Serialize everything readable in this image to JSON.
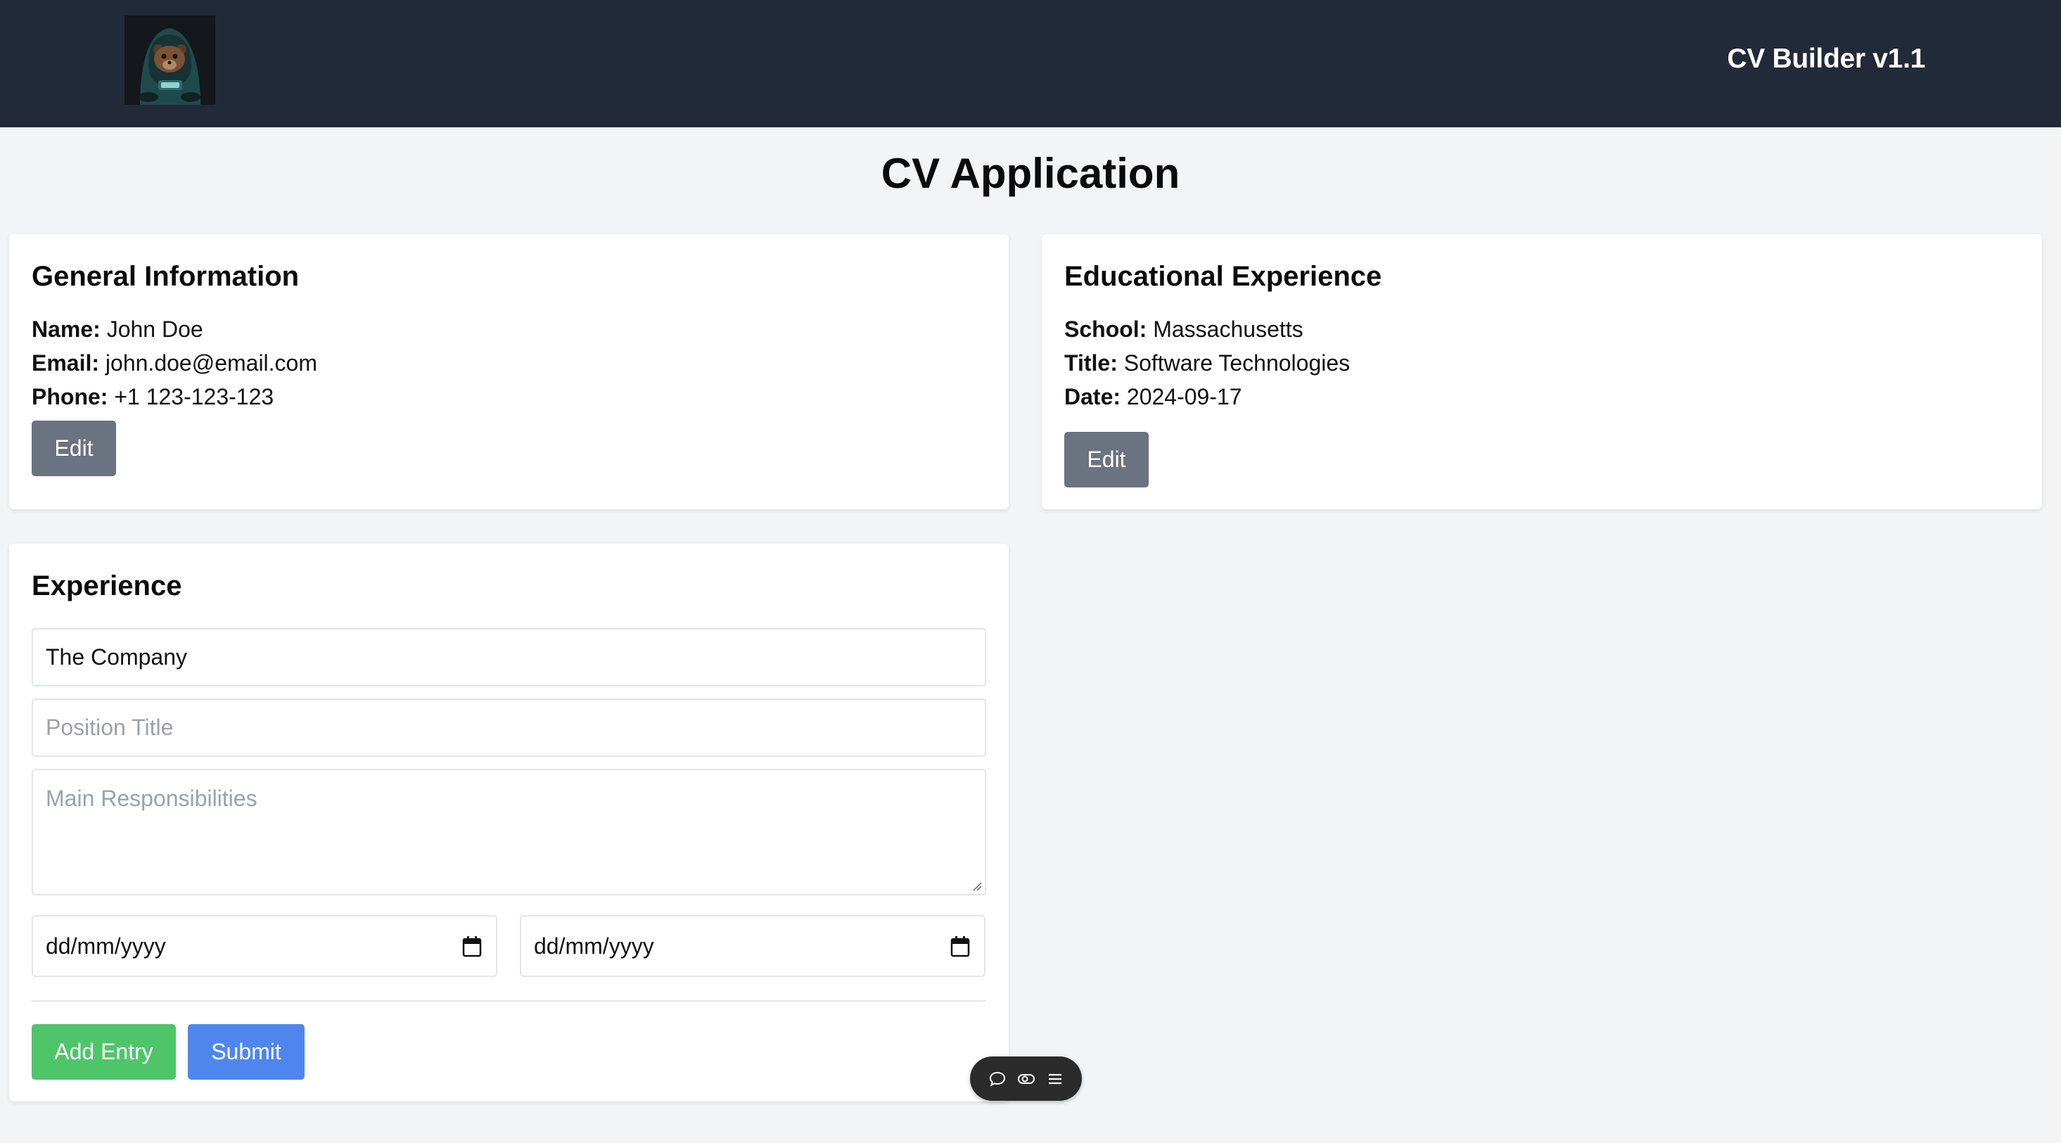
{
  "header": {
    "brand": "CV Builder v1.1",
    "logo_icon": "bear-hoodie-logo"
  },
  "page": {
    "title": "CV Application"
  },
  "general": {
    "title": "General Information",
    "name_label": "Name:",
    "name_value": "John Doe",
    "email_label": "Email:",
    "email_value": "john.doe@email.com",
    "phone_label": "Phone:",
    "phone_value": "+1 123-123-123",
    "edit_label": "Edit"
  },
  "education": {
    "title": "Educational Experience",
    "school_label": "School:",
    "school_value": "Massachusetts",
    "title_label": "Title:",
    "title_value": "Software Technologies",
    "date_label": "Date:",
    "date_value": "2024-09-17",
    "edit_label": "Edit"
  },
  "experience": {
    "title": "Experience",
    "company_value": "The Company",
    "position_placeholder": "Position Title",
    "responsibilities_placeholder": "Main Responsibilities",
    "start_date_placeholder": "dd/mm/yyyy",
    "end_date_placeholder": "dd/mm/yyyy",
    "add_label": "Add Entry",
    "submit_label": "Submit"
  },
  "toolbar": {
    "icons": [
      "chat-bubble-icon",
      "toggle-view-icon",
      "menu-icon"
    ]
  },
  "colors": {
    "navbar": "#222938",
    "background": "#f3f4f6",
    "edit_button": "#6b7280",
    "add_button": "#4fc56a",
    "submit_button": "#4f86ee"
  }
}
